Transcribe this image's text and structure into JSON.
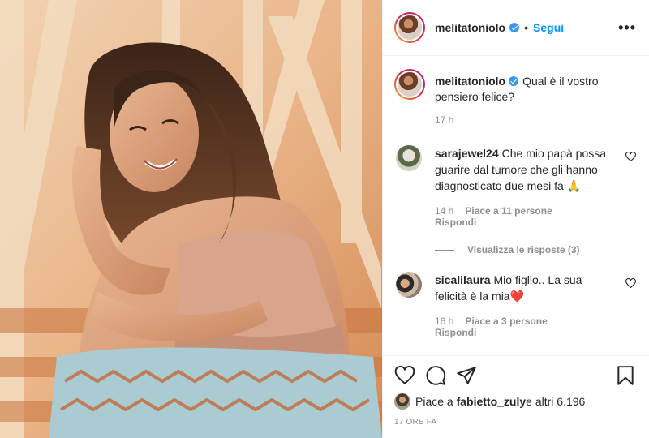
{
  "header": {
    "username": "melitatoniolo",
    "separator": "•",
    "follow_label": "Segui",
    "more_label": "•••"
  },
  "caption": {
    "username": "melitatoniolo",
    "text": "Qual è il vostro pensiero felice?",
    "time": "17 h"
  },
  "comments": [
    {
      "username": "sarajewel24",
      "text": "Che mio papà possa guarire dal tumore che gli hanno diagnosticato due mesi fa 🙏",
      "time": "14 h",
      "likes": "Piace a 11 persone",
      "reply": "Rispondi"
    },
    {
      "username": "sicalilaura",
      "text": "Mio figlio.. La sua felicità è la mia❤️",
      "time": "16 h",
      "likes": "Piace a 3 persone",
      "reply": "Rispondi"
    }
  ],
  "view_replies": "Visualizza le risposte (3)",
  "likes_summary": {
    "prefix": "Piace a ",
    "user": "fabietto_zuly",
    "suffix": " e altri 6.196"
  },
  "post_time": "17 ORE FA",
  "icons": {
    "like": "heart-icon",
    "comment": "comment-icon",
    "share": "share-icon",
    "save": "bookmark-icon",
    "verified": "verified-badge-icon"
  },
  "colors": {
    "link": "#0095f6",
    "verified": "#3897f0",
    "muted": "#8e8e8e"
  }
}
